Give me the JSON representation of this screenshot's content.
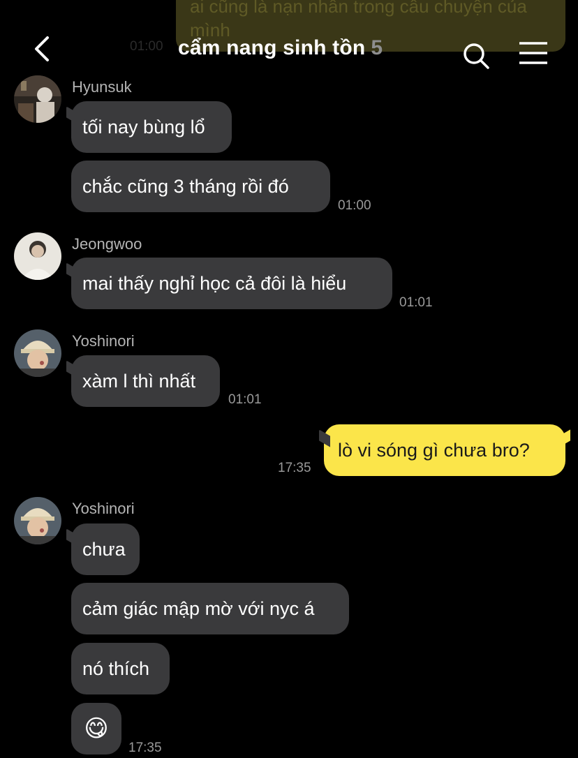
{
  "previous": {
    "text": "ai cũng là nạn nhân trong câu chuyện của mình",
    "time": "01:00"
  },
  "header": {
    "title": "cẩm nang sinh tồn",
    "member_count": "5",
    "back_icon": "chevron-left-icon",
    "search_icon": "search-icon",
    "menu_icon": "hamburger-menu-icon"
  },
  "messages": [
    {
      "sender": "Hyunsuk",
      "bubbles": [
        "tối nay bùng lổ",
        "chắc cũng 3 tháng rồi đó"
      ],
      "time": "01:00"
    },
    {
      "sender": "Jeongwoo",
      "bubbles": [
        "mai thấy nghỉ học cả đôi là hiểu"
      ],
      "time": "01:01"
    },
    {
      "sender": "Yoshinori",
      "bubbles": [
        "xàm l thì nhất"
      ],
      "time": "01:01"
    },
    {
      "sender": "me",
      "bubbles": [
        "lò vi sóng gì chưa bro?"
      ],
      "time": "17:35"
    },
    {
      "sender": "Yoshinori",
      "bubbles": [
        "chưa",
        "cảm giác mập mờ với nyc á",
        "nó thích",
        "😋"
      ],
      "time": "17:35"
    }
  ],
  "colors": {
    "my_bubble": "#fbe54a",
    "their_bubble": "#3a3a3c",
    "background": "#000000"
  }
}
